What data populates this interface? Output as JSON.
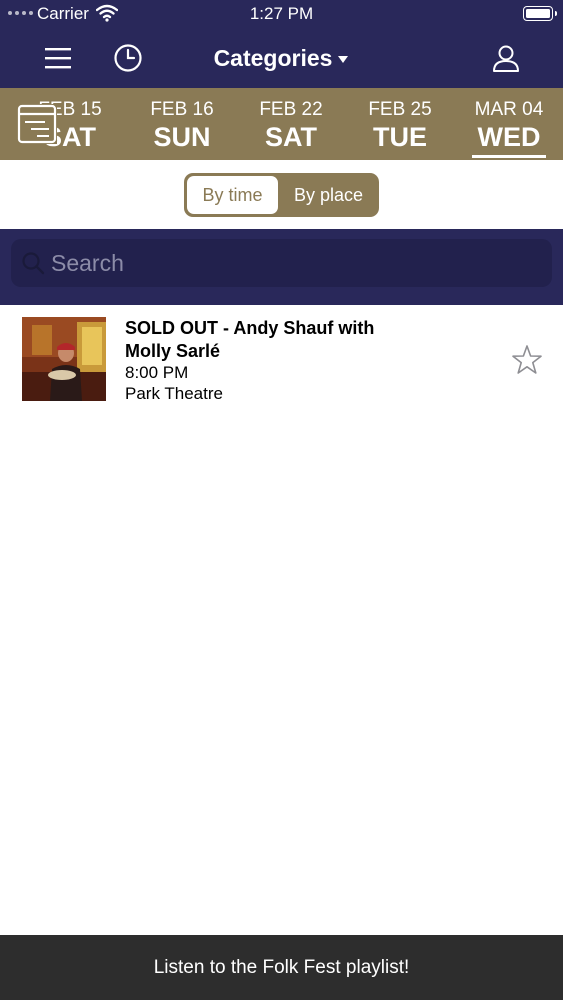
{
  "status": {
    "carrier": "Carrier",
    "time": "1:27 PM"
  },
  "nav": {
    "title": "Categories"
  },
  "dates": [
    {
      "month_day": "FEB 15",
      "weekday": "SAT",
      "active": false
    },
    {
      "month_day": "FEB 16",
      "weekday": "SUN",
      "active": false
    },
    {
      "month_day": "FEB 22",
      "weekday": "SAT",
      "active": false
    },
    {
      "month_day": "FEB 25",
      "weekday": "TUE",
      "active": false
    },
    {
      "month_day": "MAR 04",
      "weekday": "WED",
      "active": true
    }
  ],
  "segment": {
    "by_time": "By time",
    "by_place": "By place",
    "selected": "by_time"
  },
  "search": {
    "placeholder": "Search",
    "value": ""
  },
  "events": [
    {
      "title": "SOLD OUT - Andy Shauf with Molly Sarlé",
      "time": "8:00 PM",
      "venue": "Park Theatre",
      "starred": false
    }
  ],
  "footer": {
    "playlist_label": "Listen to the Folk Fest playlist!"
  },
  "colors": {
    "navy": "#29285a",
    "gold": "#8a7a55",
    "footer": "#2d2d2d"
  },
  "icons": {
    "menu": "hamburger-icon",
    "history": "clock-icon",
    "user": "user-icon",
    "calendar": "calendar-filter-icon",
    "search": "search-icon",
    "star": "star-outline-icon"
  }
}
